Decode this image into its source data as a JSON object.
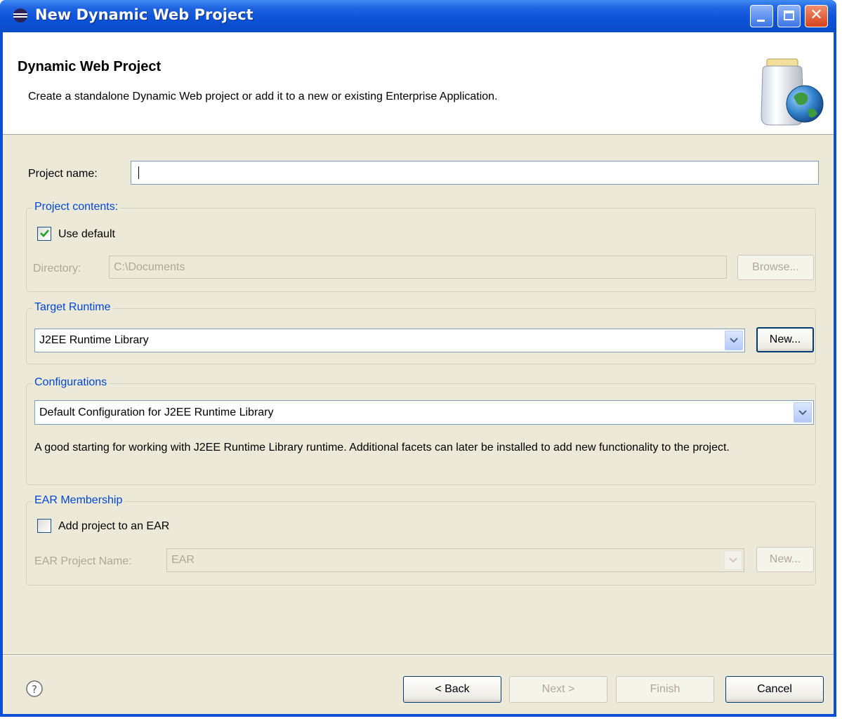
{
  "window": {
    "title": "New Dynamic Web Project"
  },
  "banner": {
    "title": "Dynamic Web Project",
    "description": "Create a standalone Dynamic Web project or add it to a new or existing Enterprise Application."
  },
  "project_name": {
    "label": "Project name:",
    "value": ""
  },
  "project_contents": {
    "title": "Project contents:",
    "use_default": {
      "label": "Use default",
      "checked": true
    },
    "directory_label": "Directory:",
    "directory_value": "C:\\Documents",
    "browse_label": "Browse..."
  },
  "target_runtime": {
    "title": "Target Runtime",
    "selected": "J2EE Runtime Library",
    "new_label": "New..."
  },
  "configurations": {
    "title": "Configurations",
    "selected": "Default Configuration for J2EE Runtime Library",
    "description": "A good starting for working with J2EE Runtime Library runtime. Additional facets can later be installed to add new functionality to the project."
  },
  "ear_membership": {
    "title": "EAR Membership",
    "add_to_ear": {
      "label": "Add project to an EAR",
      "checked": false
    },
    "project_name_label": "EAR Project Name:",
    "project_name_value": "EAR",
    "new_label": "New..."
  },
  "footer": {
    "back_label": "< Back",
    "next_label": "Next >",
    "finish_label": "Finish",
    "cancel_label": "Cancel"
  },
  "icons": [
    "eclipse-icon",
    "minimize-icon",
    "maximize-icon",
    "close-icon",
    "web-project-jar-globe-icon",
    "checkmark-icon",
    "chevron-down-icon",
    "help-icon"
  ],
  "colors": {
    "title_bar": "#0c52d8",
    "dialog_bg": "#ece9d8",
    "group_title": "#0046d5",
    "disabled_text": "#aca899"
  }
}
